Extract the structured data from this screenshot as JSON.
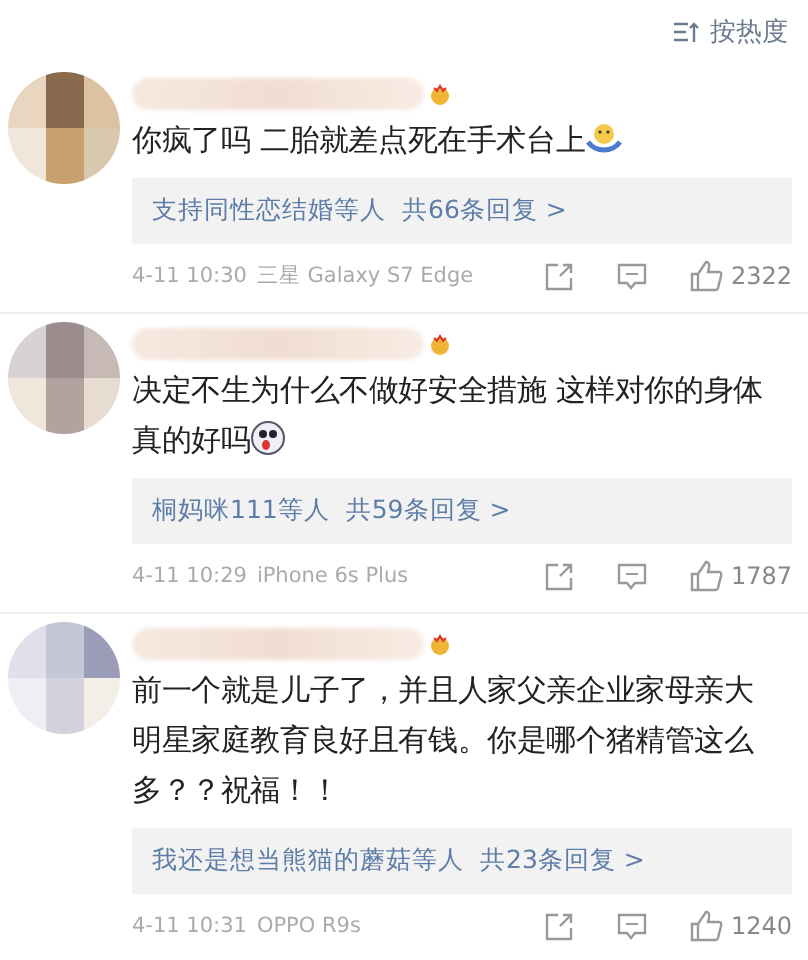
{
  "sort_label": "按热度",
  "comments": [
    {
      "badge": true,
      "text": "你疯了吗 二胎就差点死在手术台上",
      "emoji": {
        "kind": "shrug"
      },
      "replier": "支持同性恋结婚等人",
      "reply_count": "共66条回复 >",
      "time": "4-11 10:30",
      "device": "三星 Galaxy S7 Edge",
      "likes": "2322"
    },
    {
      "badge": true,
      "text": "决定不生为什么不做好安全措施  这样对你的身体真的好吗",
      "emoji": {
        "kind": "ghost"
      },
      "replier": "桐妈咪111等人",
      "reply_count": "共59条回复 >",
      "time": "4-11 10:29",
      "device": "iPhone 6s Plus",
      "likes": "1787"
    },
    {
      "badge": true,
      "text": "前一个就是儿子了，并且人家父亲企业家母亲大明星家庭教育良好且有钱。你是哪个猪精管这么多？？祝福！！",
      "replier": "我还是想当熊猫的蘑菇等人",
      "reply_count": "共23条回复 >",
      "time": "4-11 10:31",
      "device": "OPPO R9s",
      "likes": "1240"
    }
  ]
}
